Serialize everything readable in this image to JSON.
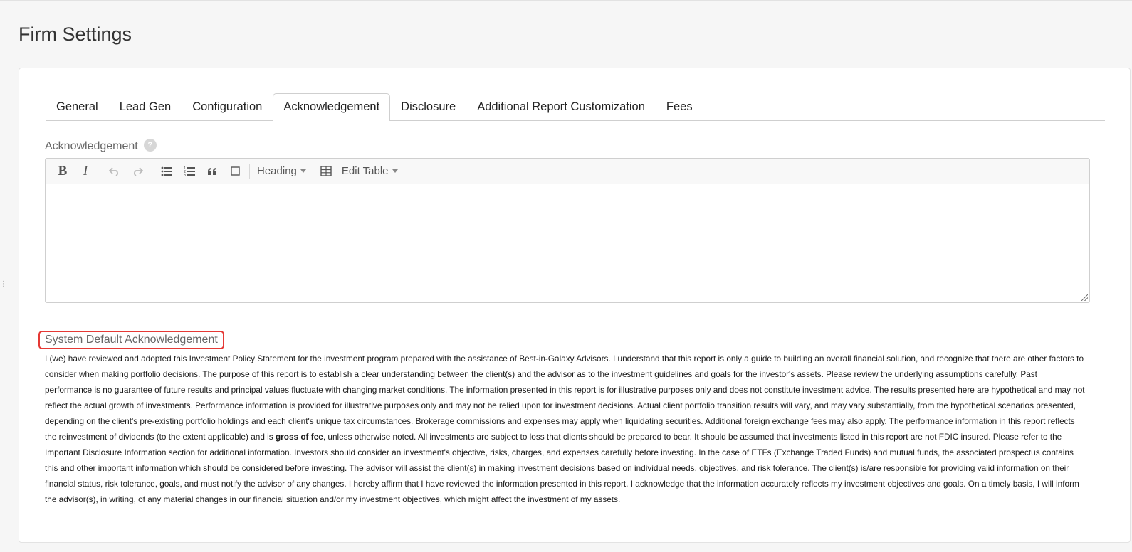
{
  "page": {
    "title": "Firm Settings"
  },
  "tabs": [
    {
      "label": "General",
      "active": false
    },
    {
      "label": "Lead Gen",
      "active": false
    },
    {
      "label": "Configuration",
      "active": false
    },
    {
      "label": "Acknowledgement",
      "active": true
    },
    {
      "label": "Disclosure",
      "active": false
    },
    {
      "label": "Additional Report Customization",
      "active": false
    },
    {
      "label": "Fees",
      "active": false
    }
  ],
  "editor": {
    "label": "Acknowledgement",
    "help_icon": "?",
    "toolbar": {
      "bold": "B",
      "italic": "I",
      "heading_label": "Heading",
      "edit_table_label": "Edit Table"
    },
    "content": ""
  },
  "system_default": {
    "label": "System Default Acknowledgement",
    "text_before_bold": "I (we) have reviewed and adopted this Investment Policy Statement for the investment program prepared with the assistance of Best-in-Galaxy Advisors. I understand that this report is only a guide to building an overall financial solution, and recognize that there are other factors to consider when making portfolio decisions. The purpose of this report is to establish a clear understanding between the client(s) and the advisor as to the investment guidelines and goals for the investor's assets. Please review the underlying assumptions carefully. Past performance is no guarantee of future results and principal values fluctuate with changing market conditions. The information presented in this report is for illustrative purposes only and does not constitute investment advice. The results presented here are hypothetical and may not reflect the actual growth of investments. Performance information is provided for illustrative purposes only and may not be relied upon for investment decisions. Actual client portfolio transition results will vary, and may vary substantially, from the hypothetical scenarios presented, depending on the client's pre-existing portfolio holdings and each client's unique tax circumstances. Brokerage commissions and expenses may apply when liquidating securities. Additional foreign exchange fees may also apply. The performance information in this report reflects the reinvestment of dividends (to the extent applicable) and is ",
    "bold_text": "gross of fee",
    "text_after_bold": ", unless otherwise noted. All investments are subject to loss that clients should be prepared to bear. It should be assumed that investments listed in this report are not FDIC insured. Please refer to the Important Disclosure Information section for additional information. Investors should consider an investment's objective, risks, charges, and expenses carefully before investing. In the case of ETFs (Exchange Traded Funds) and mutual funds, the associated prospectus contains this and other important information which should be considered before investing. The advisor will assist the client(s) in making investment decisions based on individual needs, objectives, and risk tolerance. The client(s) is/are responsible for providing valid information on their financial status, risk tolerance, goals, and must notify the advisor of any changes. I hereby affirm that I have reviewed the information presented in this report. I acknowledge that the information accurately reflects my investment objectives and goals. On a timely basis, I will inform the advisor(s), in writing, of any material changes in our financial situation and/or my investment objectives, which might affect the investment of my assets."
  },
  "colors": {
    "highlight_border": "#e53935",
    "background": "#f6f6f6"
  }
}
